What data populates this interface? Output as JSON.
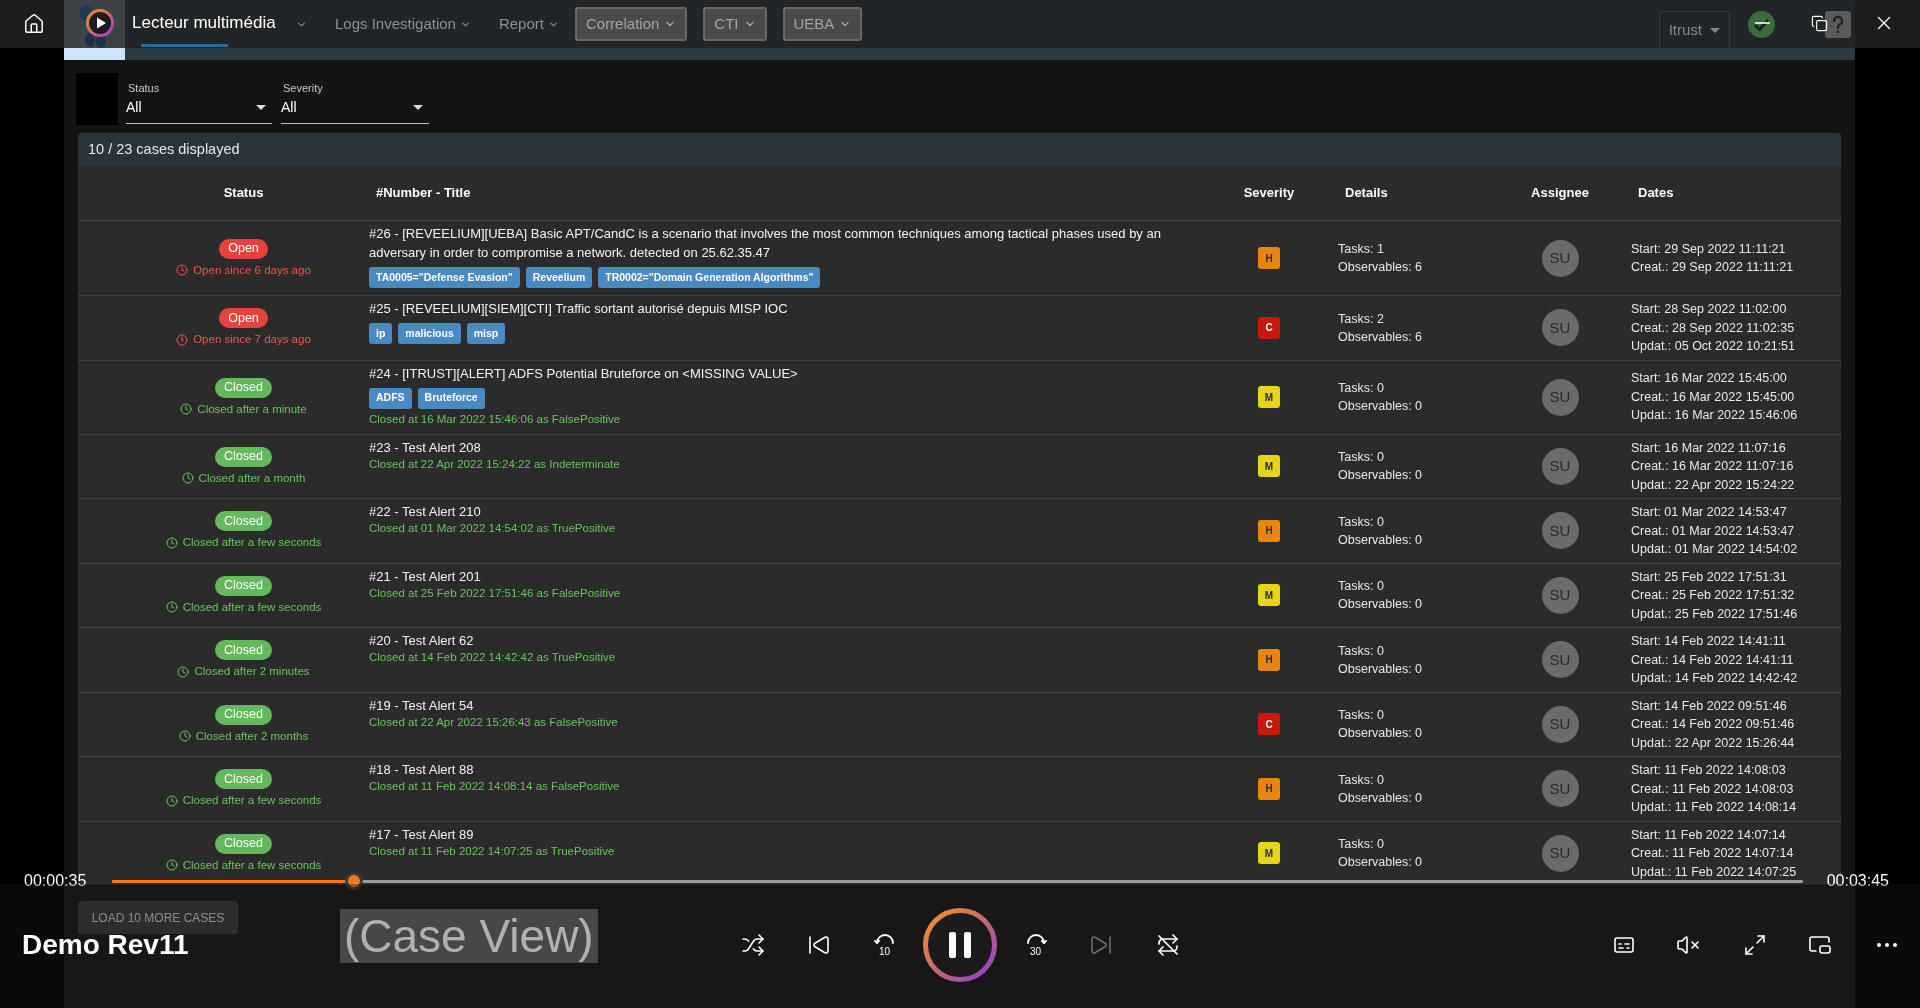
{
  "player": {
    "title": "Lecteur multimédia",
    "media_title": "Demo Rev11",
    "elapsed": "00:00:35",
    "duration": "00:03:45",
    "progress": {
      "level": 0.143
    },
    "playing": true,
    "shuffle": false,
    "repeat": false,
    "muted": true,
    "skip_back": "10",
    "skip_forward": "30",
    "previous_disabled": false,
    "next_disabled": true
  },
  "video": {
    "nav": {
      "items": [
        {
          "kind": "link",
          "selected": true
        },
        {
          "kind": "menu",
          "selected": false
        },
        {
          "kind": "menu",
          "label": "Logs Investigation",
          "selected": false
        },
        {
          "kind": "menu",
          "label": "Report",
          "selected": false
        },
        {
          "kind": "button",
          "label": "Correlation",
          "selected": false
        },
        {
          "kind": "button",
          "label": "CTI",
          "selected": false
        },
        {
          "kind": "button",
          "label": "UEBA",
          "selected": false
        }
      ],
      "organisation": "Itrust"
    },
    "filters": [
      {
        "label": "Status",
        "value": "All"
      },
      {
        "label": "Severity",
        "value": "All"
      }
    ],
    "cases_count": "10 / 23 cases displayed",
    "table": {
      "columns": [
        "Status",
        "#Number - Title",
        "Severity",
        "Details",
        "Assignee",
        "Dates"
      ],
      "rows": [
        {
          "status": {
            "label": "Open",
            "kind": "open",
            "note": "Open since 6 days ago"
          },
          "title": "#26 - [REVEELIUM][UEBA] Basic APT/CandC is a scenario that involves the most common techniques among tactical phases used by an adversary in order to compromise a network. detected on 25.62.35.47",
          "tags": [
            "TA0005=\"Defense Evasion\"",
            "Reveelium",
            "TR0002=\"Domain Generation Algorithms\""
          ],
          "severity": {
            "label": "H",
            "color": "#e8850e"
          },
          "details": [
            "Tasks: 1",
            "Observables: 6"
          ],
          "assignee": "SU",
          "dates": [
            "Start: 29 Sep 2022 11:11:21",
            "Creat.: 29 Sep 2022 11:11:21"
          ]
        },
        {
          "status": {
            "label": "Open",
            "kind": "open",
            "note": "Open since 7 days ago"
          },
          "title": "#25 - [REVEELIUM][SIEM][CTI] Traffic sortant autorisé depuis MISP IOC",
          "tags": [
            "ip",
            "malicious",
            "misp"
          ],
          "severity": {
            "label": "C",
            "color": "#c8180c"
          },
          "details": [
            "Tasks: 2",
            "Observables: 6"
          ],
          "assignee": "SU",
          "dates": [
            "Start: 28 Sep 2022 11:02:00",
            "Creat.: 28 Sep 2022 11:02:35",
            "Updat.: 05 Oct 2022 10:21:51"
          ]
        },
        {
          "status": {
            "label": "Closed",
            "kind": "closed",
            "note": "Closed after a minute"
          },
          "title": "#24 - [ITRUST][ALERT] ADFS Potential Bruteforce on <MISSING VALUE>",
          "tags": [
            "ADFS",
            "Bruteforce"
          ],
          "resolution": "Closed at 16 Mar 2022 15:46:06 as FalsePositive",
          "severity": {
            "label": "M",
            "color": "#e6d41a"
          },
          "details": [
            "Tasks: 0",
            "Observables: 0"
          ],
          "assignee": "SU",
          "dates": [
            "Start: 16 Mar 2022 15:45:00",
            "Creat.: 16 Mar 2022 15:45:00",
            "Updat.: 16 Mar 2022 15:46:06"
          ]
        },
        {
          "status": {
            "label": "Closed",
            "kind": "closed",
            "note": "Closed after a month"
          },
          "title": "#23 - Test Alert 208",
          "resolution": "Closed at 22 Apr 2022 15:24:22 as Indeterminate",
          "severity": {
            "label": "M",
            "color": "#e6d41a"
          },
          "details": [
            "Tasks: 0",
            "Observables: 0"
          ],
          "assignee": "SU",
          "dates": [
            "Start: 16 Mar 2022 11:07:16",
            "Creat.: 16 Mar 2022 11:07:16",
            "Updat.: 22 Apr 2022 15:24:22"
          ]
        },
        {
          "status": {
            "label": "Closed",
            "kind": "closed",
            "note": "Closed after a few seconds"
          },
          "title": "#22 - Test Alert 210",
          "resolution": "Closed at 01 Mar 2022 14:54:02 as TruePositive",
          "severity": {
            "label": "H",
            "color": "#e8850e"
          },
          "details": [
            "Tasks: 0",
            "Observables: 0"
          ],
          "assignee": "SU",
          "dates": [
            "Start: 01 Mar 2022 14:53:47",
            "Creat.: 01 Mar 2022 14:53:47",
            "Updat.: 01 Mar 2022 14:54:02"
          ]
        },
        {
          "status": {
            "label": "Closed",
            "kind": "closed",
            "note": "Closed after a few seconds"
          },
          "title": "#21 - Test Alert 201",
          "resolution": "Closed at 25 Feb 2022 17:51:46 as FalsePositive",
          "severity": {
            "label": "M",
            "color": "#e6d41a"
          },
          "details": [
            "Tasks: 0",
            "Observables: 0"
          ],
          "assignee": "SU",
          "dates": [
            "Start: 25 Feb 2022 17:51:31",
            "Creat.: 25 Feb 2022 17:51:32",
            "Updat.: 25 Feb 2022 17:51:46"
          ]
        },
        {
          "status": {
            "label": "Closed",
            "kind": "closed",
            "note": "Closed after 2 minutes"
          },
          "title": "#20 - Test Alert 62",
          "resolution": "Closed at 14 Feb 2022 14:42:42 as TruePositive",
          "severity": {
            "label": "H",
            "color": "#e8850e"
          },
          "details": [
            "Tasks: 0",
            "Observables: 0"
          ],
          "assignee": "SU",
          "dates": [
            "Start: 14 Feb 2022 14:41:11",
            "Creat.: 14 Feb 2022 14:41:11",
            "Updat.: 14 Feb 2022 14:42:42"
          ]
        },
        {
          "status": {
            "label": "Closed",
            "kind": "closed",
            "note": "Closed after 2 months"
          },
          "title": "#19 - Test Alert 54",
          "resolution": "Closed at 22 Apr 2022 15:26:43 as FalsePositive",
          "severity": {
            "label": "C",
            "color": "#c8180c"
          },
          "details": [
            "Tasks: 0",
            "Observables: 0"
          ],
          "assignee": "SU",
          "dates": [
            "Start: 14 Feb 2022 09:51:46",
            "Creat.: 14 Feb 2022 09:51:46",
            "Updat.: 22 Apr 2022 15:26:44"
          ]
        },
        {
          "status": {
            "label": "Closed",
            "kind": "closed",
            "note": "Closed after a few seconds"
          },
          "title": "#18 - Test Alert 88",
          "resolution": "Closed at 11 Feb 2022 14:08:14 as FalsePositive",
          "severity": {
            "label": "H",
            "color": "#e8850e"
          },
          "details": [
            "Tasks: 0",
            "Observables: 0"
          ],
          "assignee": "SU",
          "dates": [
            "Start: 11 Feb 2022 14:08:03",
            "Creat.: 11 Feb 2022 14:08:03",
            "Updat.: 11 Feb 2022 14:08:14"
          ]
        },
        {
          "status": {
            "label": "Closed",
            "kind": "closed",
            "note": "Closed after a few seconds"
          },
          "title": "#17 - Test Alert 89",
          "resolution": "Closed at 11 Feb 2022 14:07:25 as TruePositive",
          "severity": {
            "label": "M",
            "color": "#e6d41a"
          },
          "details": [
            "Tasks: 0",
            "Observables: 0"
          ],
          "assignee": "SU",
          "dates": [
            "Start: 11 Feb 2022 14:07:14",
            "Creat.: 11 Feb 2022 14:07:14",
            "Updat.: 11 Feb 2022 14:07:25"
          ]
        }
      ]
    },
    "load_more": "LOAD 10 MORE CASES",
    "caption": "(Case View)"
  }
}
